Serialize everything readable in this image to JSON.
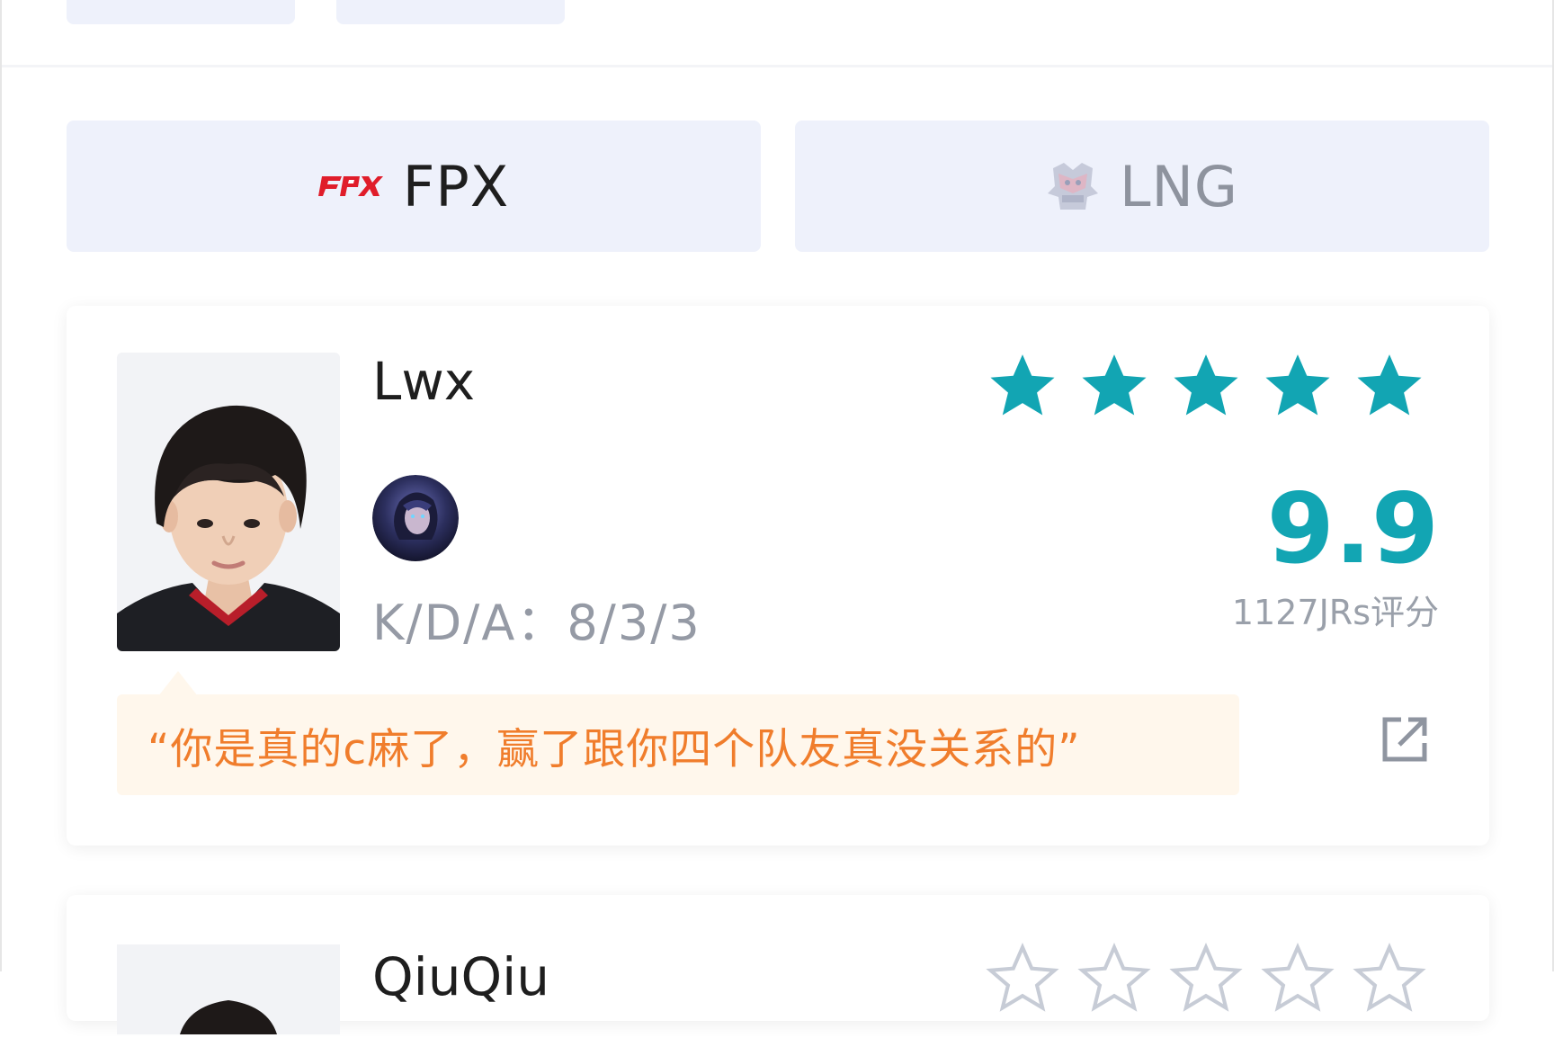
{
  "teams": {
    "home": {
      "name": "FPX",
      "logo_icon": "fpx-logo",
      "brand_color": "#e01d2a"
    },
    "away": {
      "name": "LNG",
      "logo_icon": "lng-logo"
    }
  },
  "players": [
    {
      "name": "Lwx",
      "rating_stars": 5,
      "max_stars": 5,
      "kda": "K/D/A：8/3/3",
      "score": "9.9",
      "rating_count": "1127JRs评分",
      "comment": "“你是真的c麻了，赢了跟你四个队友真没关系的”",
      "hero_icon": "champion-portrait",
      "accent_color": "#12a5b3"
    },
    {
      "name": "QiuQiu",
      "rating_stars": 0,
      "max_stars": 5
    }
  ],
  "colors": {
    "accent": "#12a5b3",
    "comment_text": "#f07d2c",
    "comment_bg": "#fff7ec",
    "tab_bg": "#eef1fb",
    "muted_text": "#959aa5"
  }
}
